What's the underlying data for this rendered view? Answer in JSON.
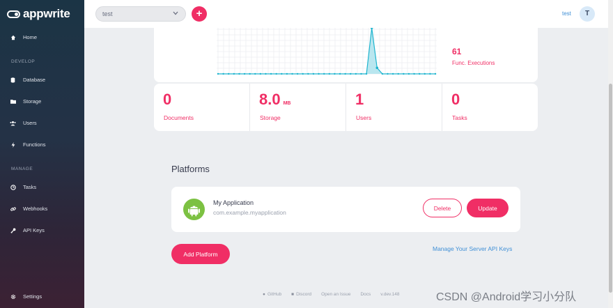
{
  "app": {
    "logo_text": "appwrite"
  },
  "sidebar": {
    "home": "Home",
    "section_develop": "DEVELOP",
    "develop": [
      "Database",
      "Storage",
      "Users",
      "Functions"
    ],
    "section_manage": "MANAGE",
    "manage": [
      "Tasks",
      "Webhooks",
      "API Keys"
    ],
    "settings": "Settings"
  },
  "topbar": {
    "project": "test",
    "add_symbol": "+",
    "user_name": "test",
    "avatar_initial": "T"
  },
  "executions": {
    "value": "61",
    "label": "Func. Executions"
  },
  "stats": [
    {
      "value": "0",
      "unit": "",
      "label": "Documents"
    },
    {
      "value": "8.0",
      "unit": "MB",
      "label": "Storage"
    },
    {
      "value": "1",
      "unit": "",
      "label": "Users"
    },
    {
      "value": "0",
      "unit": "",
      "label": "Tasks"
    }
  ],
  "platforms": {
    "title": "Platforms",
    "items": [
      {
        "name": "My Application",
        "id": "com.example.myapplication",
        "delete_label": "Delete",
        "update_label": "Update"
      }
    ],
    "add_label": "Add Platform",
    "api_keys_link": "Manage Your Server API Keys"
  },
  "footer": {
    "github": "GitHub",
    "discord": "Discord",
    "issue": "Open an Issue",
    "docs": "Docs",
    "version": "v.dev.148"
  },
  "watermark": "CSDN @Android学习小分队",
  "chart_data": {
    "type": "area",
    "series": [
      {
        "values": [
          0,
          0,
          0,
          0,
          0,
          0,
          0,
          0,
          0,
          0,
          0,
          0,
          0,
          0,
          0,
          0,
          0,
          0,
          0,
          0,
          0,
          0,
          0,
          0,
          0,
          0,
          0,
          0,
          0,
          61,
          8,
          0,
          0,
          0,
          0,
          0,
          0,
          0,
          0,
          0,
          0,
          0
        ]
      }
    ],
    "colors": {
      "line": "#1fb5cf",
      "fill": "#b9e6ef"
    },
    "grid": true
  }
}
